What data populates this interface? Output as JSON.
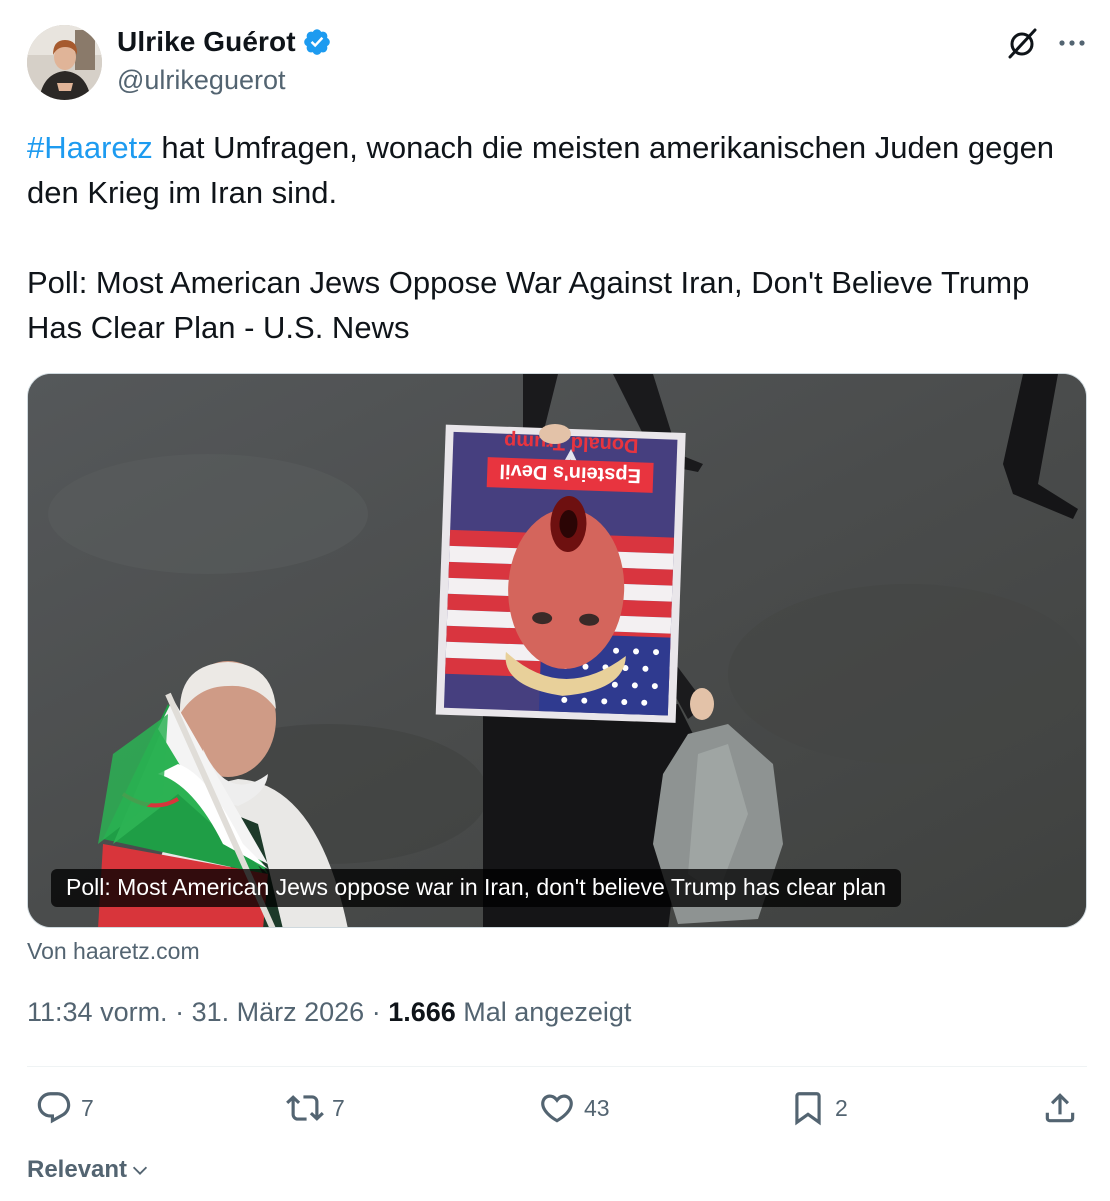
{
  "author": {
    "display_name": "Ulrike Guérot",
    "handle": "@ulrikeguerot"
  },
  "icons": {
    "verified": "verified-badge-icon",
    "grok": "grok-icon",
    "more": "more-icon",
    "reply": "reply-icon",
    "repost": "repost-icon",
    "like": "heart-icon",
    "bookmark": "bookmark-icon",
    "share": "share-icon",
    "chevron": "chevron-down-icon"
  },
  "colors": {
    "accent": "#1d9bf0",
    "text": "#0f1419",
    "secondary": "#536471"
  },
  "tweet": {
    "hashtag": "#Haaretz",
    "line1_rest": " hat Umfragen, wonach die meisten amerikanischen Juden gegen den Krieg im Iran sind.",
    "headline": "Poll: Most American Jews Oppose War Against Iran, Don't Believe Trump Has Clear Plan - U.S. News"
  },
  "card": {
    "caption": "Poll: Most American Jews oppose war in Iran, don't believe Trump has clear plan",
    "poster_line1": "Epstein's Devil",
    "poster_line2": "Donald Trump",
    "source": "Von haaretz.com"
  },
  "meta": {
    "time": "11:34 vorm.",
    "sep1": " · ",
    "date": "31. März 2026",
    "sep2": " · ",
    "views": "1.666",
    "views_label": " Mal angezeigt"
  },
  "actions": {
    "replies": "7",
    "reposts": "7",
    "likes": "43",
    "bookmarks": "2"
  },
  "sort": {
    "label": "Relevant"
  }
}
